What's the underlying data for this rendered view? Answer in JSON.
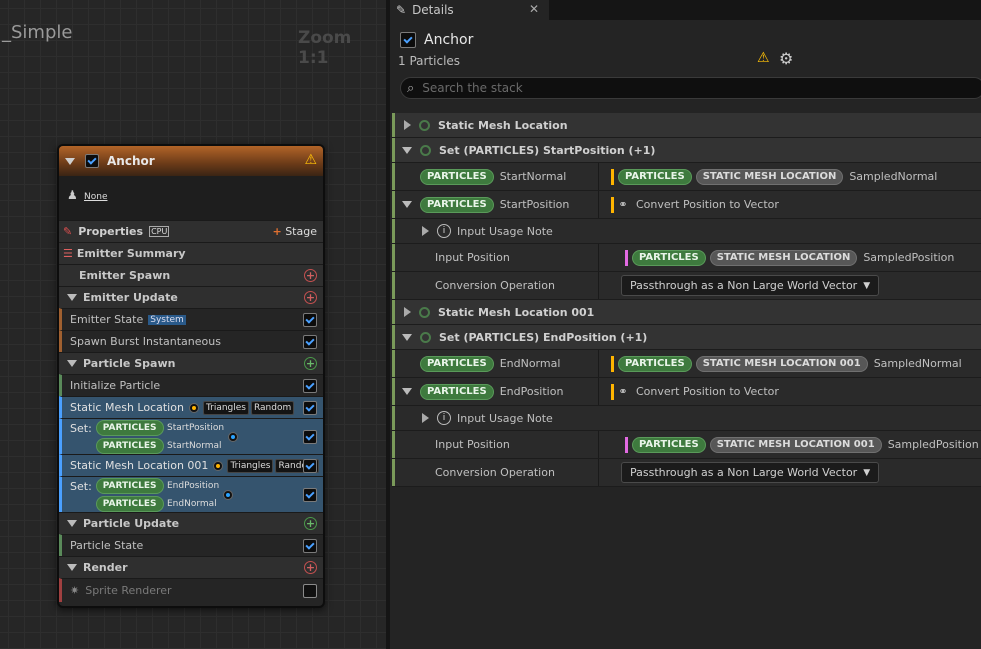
{
  "graph": {
    "title": "_Simple",
    "zoom": "Zoom 1:1"
  },
  "node": {
    "title": "Anchor",
    "none_label": "None",
    "properties": "Properties",
    "cpu": "CPU",
    "stage": "Stage",
    "emitter_summary": "Emitter Summary",
    "emitter_spawn": "Emitter Spawn",
    "emitter_update": "Emitter Update",
    "emitter_state": "Emitter State",
    "system_tag": "System",
    "spawn_burst": "Spawn Burst Instantaneous",
    "particle_spawn": "Particle Spawn",
    "initialize_particle": "Initialize Particle",
    "sml": "Static Mesh Location",
    "triangles": "Triangles",
    "random": "Random",
    "set_label": "Set:",
    "particles": "PARTICLES",
    "start_position": "StartPosition",
    "start_normal": "StartNormal",
    "sml001": "Static Mesh Location 001",
    "end_position": "EndPosition",
    "end_normal": "EndNormal",
    "particle_update": "Particle Update",
    "particle_state": "Particle State",
    "render": "Render",
    "sprite_renderer": "Sprite Renderer"
  },
  "details": {
    "tab": "Details",
    "title": "Anchor",
    "subtitle": "1 Particles",
    "search_placeholder": "Search the stack",
    "rows": {
      "sml": "Static Mesh Location",
      "set_start": "Set (PARTICLES) StartPosition (+1)",
      "particles": "PARTICLES",
      "start_normal": "StartNormal",
      "sml_tag": "STATIC MESH LOCATION",
      "sampled_normal": "SampledNormal",
      "start_position": "StartPosition",
      "convert": "Convert Position to Vector",
      "input_usage": "Input Usage Note",
      "input_position": "Input Position",
      "sampled_position": "SampledPosition",
      "conversion_op": "Conversion Operation",
      "passthrough": "Passthrough as a Non Large World Vector",
      "sml001": "Static Mesh Location 001",
      "set_end": "Set (PARTICLES) EndPosition (+1)",
      "end_normal": "EndNormal",
      "sml001_tag": "STATIC MESH LOCATION 001",
      "end_position": "EndPosition"
    }
  }
}
